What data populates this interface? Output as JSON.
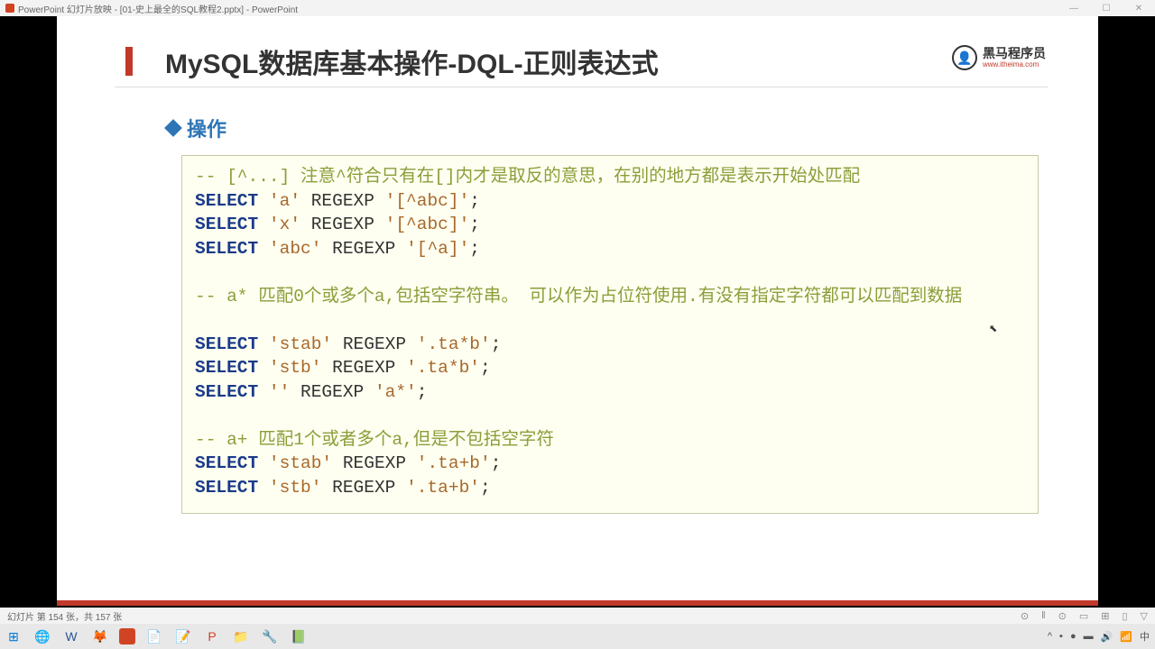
{
  "titlebar": {
    "text": "PowerPoint 幻灯片放映 - [01-史上最全的SQL教程2.pptx] - PowerPoint"
  },
  "slide": {
    "title": "MySQL数据库基本操作-DQL-正则表达式",
    "logo_text": "黑马程序员",
    "logo_url": "www.itheima.com",
    "section": "操作",
    "code": {
      "c1": "-- [^...] 注意^符合只有在[]内才是取反的意思，在别的地方都是表示开始处匹配",
      "l1_kw": "SELECT",
      "l1_s1": " 'a'",
      "l1_r": " REGEXP ",
      "l1_s2": "'[^abc]'",
      "l1_e": ";",
      "l2_kw": "SELECT",
      "l2_s1": " 'x'",
      "l2_r": " REGEXP ",
      "l2_s2": "'[^abc]'",
      "l2_e": ";",
      "l3_kw": "SELECT",
      "l3_s1": " 'abc'",
      "l3_r": " REGEXP ",
      "l3_s2": "'[^a]'",
      "l3_e": ";",
      "c2": "-- a* 匹配0个或多个a,包括空字符串。 可以作为占位符使用.有没有指定字符都可以匹配到数据",
      "l4_kw": "SELECT",
      "l4_s1": "'stab'",
      "l4_r": " REGEXP ",
      "l4_s2": "'.ta*b'",
      "l4_e": ";",
      "l5_kw": "SELECT",
      "l5_s1": "'stb'",
      "l5_r": " REGEXP ",
      "l5_s2": "'.ta*b'",
      "l5_e": ";",
      "l6_kw": "SELECT",
      "l6_s1": "''",
      "l6_r": " REGEXP ",
      "l6_s2": "'a*'",
      "l6_e": ";",
      "c3": "-- a+  匹配1个或者多个a,但是不包括空字符",
      "l7_kw": "SELECT",
      "l7_s1": "'stab'",
      "l7_r": " REGEXP ",
      "l7_s2": "'.ta+b'",
      "l7_e": ";",
      "l8_kw": "SELECT",
      "l8_s1": "'stb'",
      "l8_r": " REGEXP ",
      "l8_s2": "'.ta+b'",
      "l8_e": ";"
    }
  },
  "statusbar": {
    "slide_info": "幻灯片 第 154 张，共 157 张"
  }
}
